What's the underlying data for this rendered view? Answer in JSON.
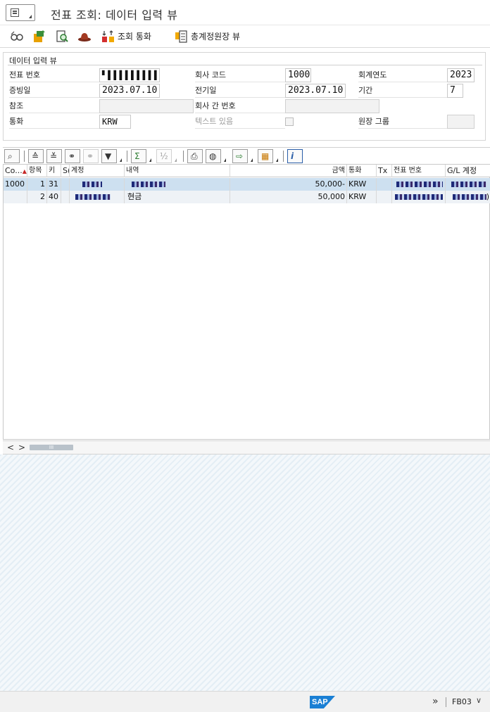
{
  "title": "전표 조회: 데이터 입력 뷰",
  "app_toolbar": {
    "items": [
      {
        "icon": "glasses-icon"
      },
      {
        "icon": "change-icon"
      },
      {
        "icon": "display-document-icon"
      },
      {
        "icon": "hat-icon"
      },
      {
        "icon": "currency-icon",
        "label": "조회 통화"
      },
      {
        "icon": "ledger-icon",
        "label": "총계정원장 뷰"
      }
    ]
  },
  "header": {
    "section_title": "데이터 입력 뷰",
    "fields": {
      "doc_number_label": "전표 번호",
      "doc_number_value": "▘▌▌▌▌▌▌▌▌▌",
      "company_code_label": "회사 코드",
      "company_code_value": "1000",
      "fiscal_year_label": "회계연도",
      "fiscal_year_value": "2023",
      "doc_date_label": "증빙일",
      "doc_date_value": "2023.07.10",
      "posting_date_label": "전기일",
      "posting_date_value": "2023.07.10",
      "period_label": "기간",
      "period_value": "7",
      "reference_label": "참조",
      "reference_value": "",
      "intercompany_label": "회사 간 번호",
      "intercompany_value": "",
      "currency_label": "통화",
      "currency_value": "KRW",
      "text_exists_label": "텍스트 있음",
      "ledger_group_label": "원장 그룹",
      "ledger_group_value": ""
    }
  },
  "grid": {
    "columns": [
      "Co...",
      "항목",
      "키",
      "S(",
      "계정",
      "내역",
      "금액",
      "통화",
      "Tx",
      "전표 번호",
      "G/L 계정"
    ],
    "rows": [
      {
        "co": "1000",
        "item": "1",
        "key": "31",
        "sg": "",
        "account": "",
        "desc": "",
        "amount": "50,000-",
        "currency": "KRW",
        "tx": "",
        "docno": "",
        "gl": ""
      },
      {
        "co": "",
        "item": "2",
        "key": "40",
        "sg": "",
        "account": "",
        "desc": "현금",
        "amount": "50,000",
        "currency": "KRW",
        "tx": "",
        "docno": "",
        "gl": ")"
      }
    ]
  },
  "scroll": {
    "left": "<",
    "right": ">",
    "thumb": "III"
  },
  "status": {
    "arrow": "»",
    "tcode": "FB03",
    "chevron": "∨",
    "logo": "SAP"
  }
}
